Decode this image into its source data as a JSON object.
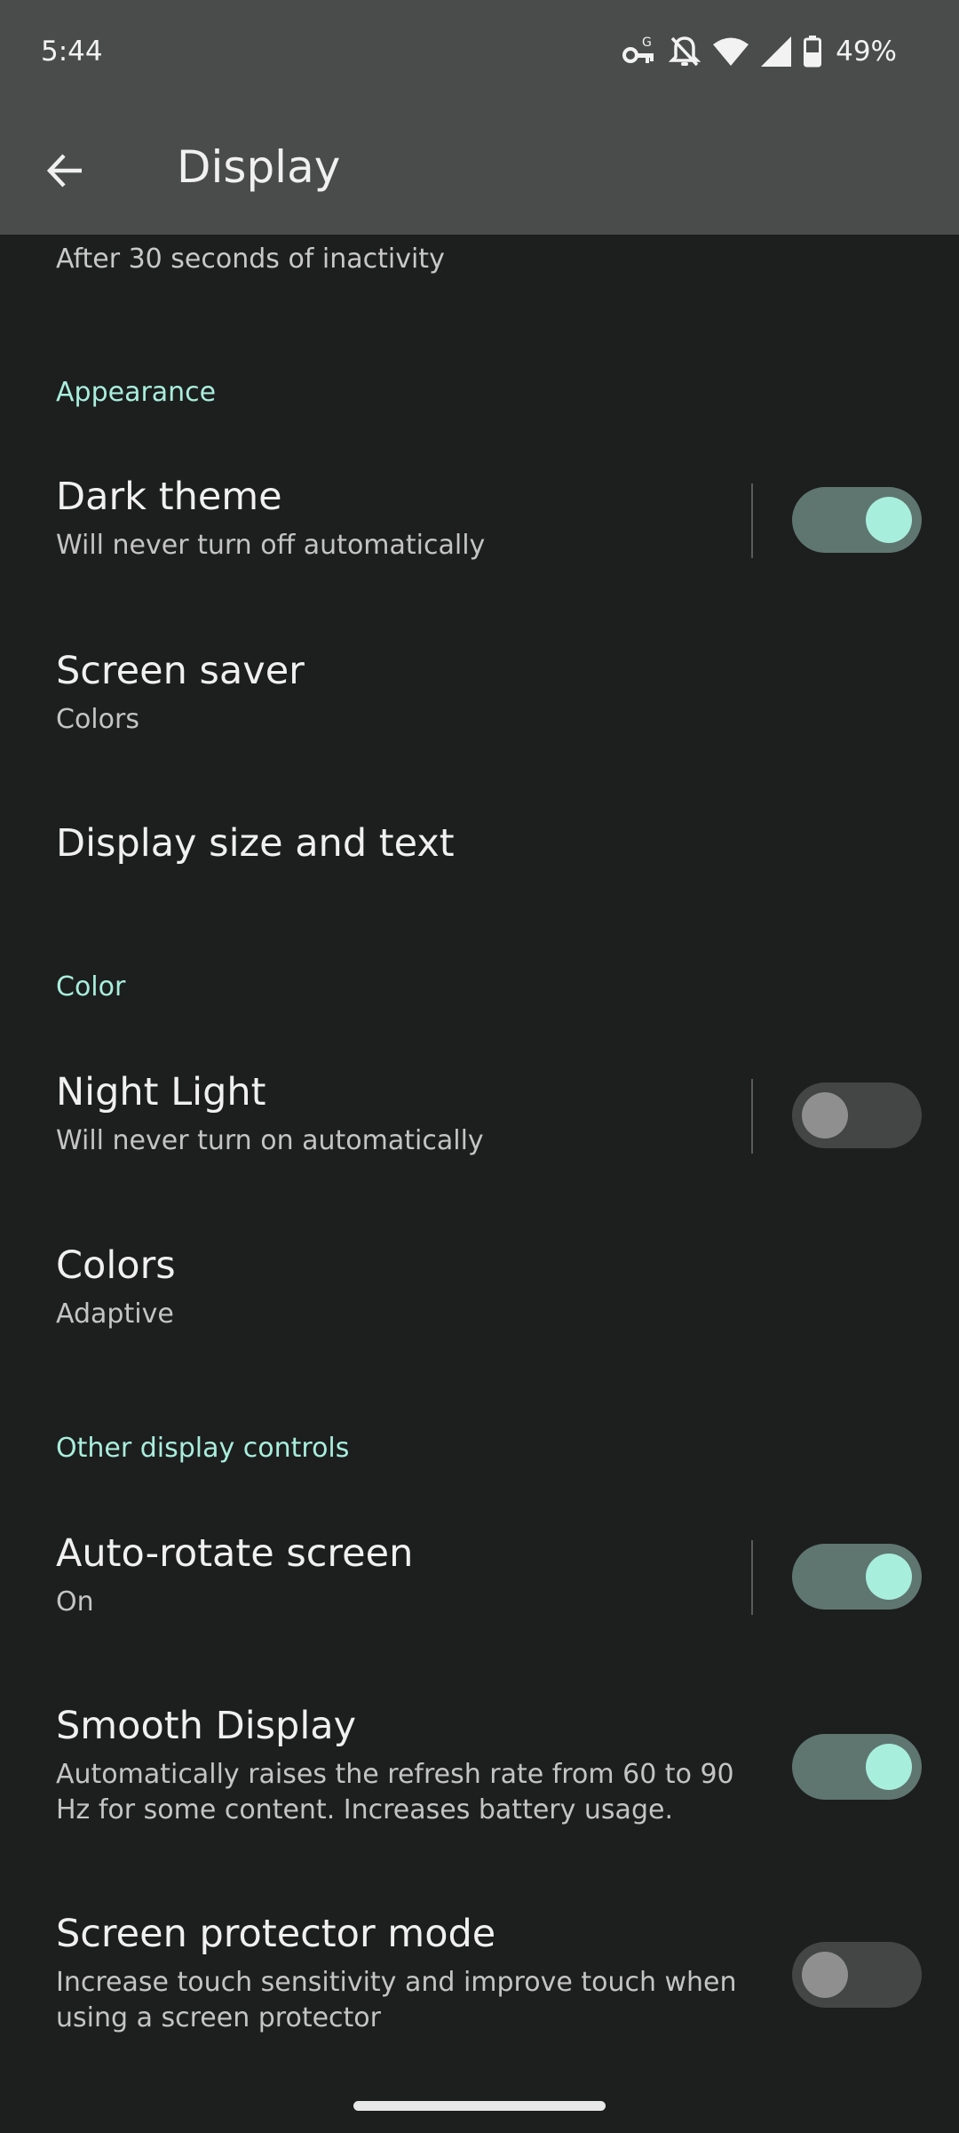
{
  "status_bar": {
    "time": "5:44",
    "battery": "49%",
    "icons": [
      "vpn-key-icon",
      "notifications-off-icon",
      "wifi-icon",
      "cell-signal-icon",
      "battery-icon"
    ]
  },
  "app_bar": {
    "title": "Display",
    "back_icon": "arrow-back-icon"
  },
  "scrolled_summary": "After 30 seconds of inactivity",
  "sections": {
    "appearance": "Appearance",
    "color": "Color",
    "other": "Other display controls"
  },
  "items": {
    "dark_theme": {
      "title": "Dark theme",
      "summary": "Will never turn off automatically",
      "toggle": "on"
    },
    "screen_saver": {
      "title": "Screen saver",
      "summary": "Colors"
    },
    "display_size": {
      "title": "Display size and text"
    },
    "night_light": {
      "title": "Night Light",
      "summary": "Will never turn on automatically",
      "toggle": "off"
    },
    "colors": {
      "title": "Colors",
      "summary": "Adaptive"
    },
    "auto_rotate": {
      "title": "Auto-rotate screen",
      "summary": "On",
      "toggle": "on"
    },
    "smooth_display": {
      "title": "Smooth Display",
      "summary": "Automatically raises the refresh rate from 60 to 90 Hz for some content. Increases battery usage.",
      "toggle": "on"
    },
    "screen_protector": {
      "title": "Screen protector mode",
      "summary": "Increase touch sensitivity and improve touch when using a screen protector",
      "toggle": "off"
    }
  },
  "colors": {
    "background": "#1d1e1e",
    "app_bar": "#4a4b4b",
    "accent": "#a8eedc",
    "toggle_on_track": "#5f7670",
    "toggle_off_track": "#444646"
  }
}
